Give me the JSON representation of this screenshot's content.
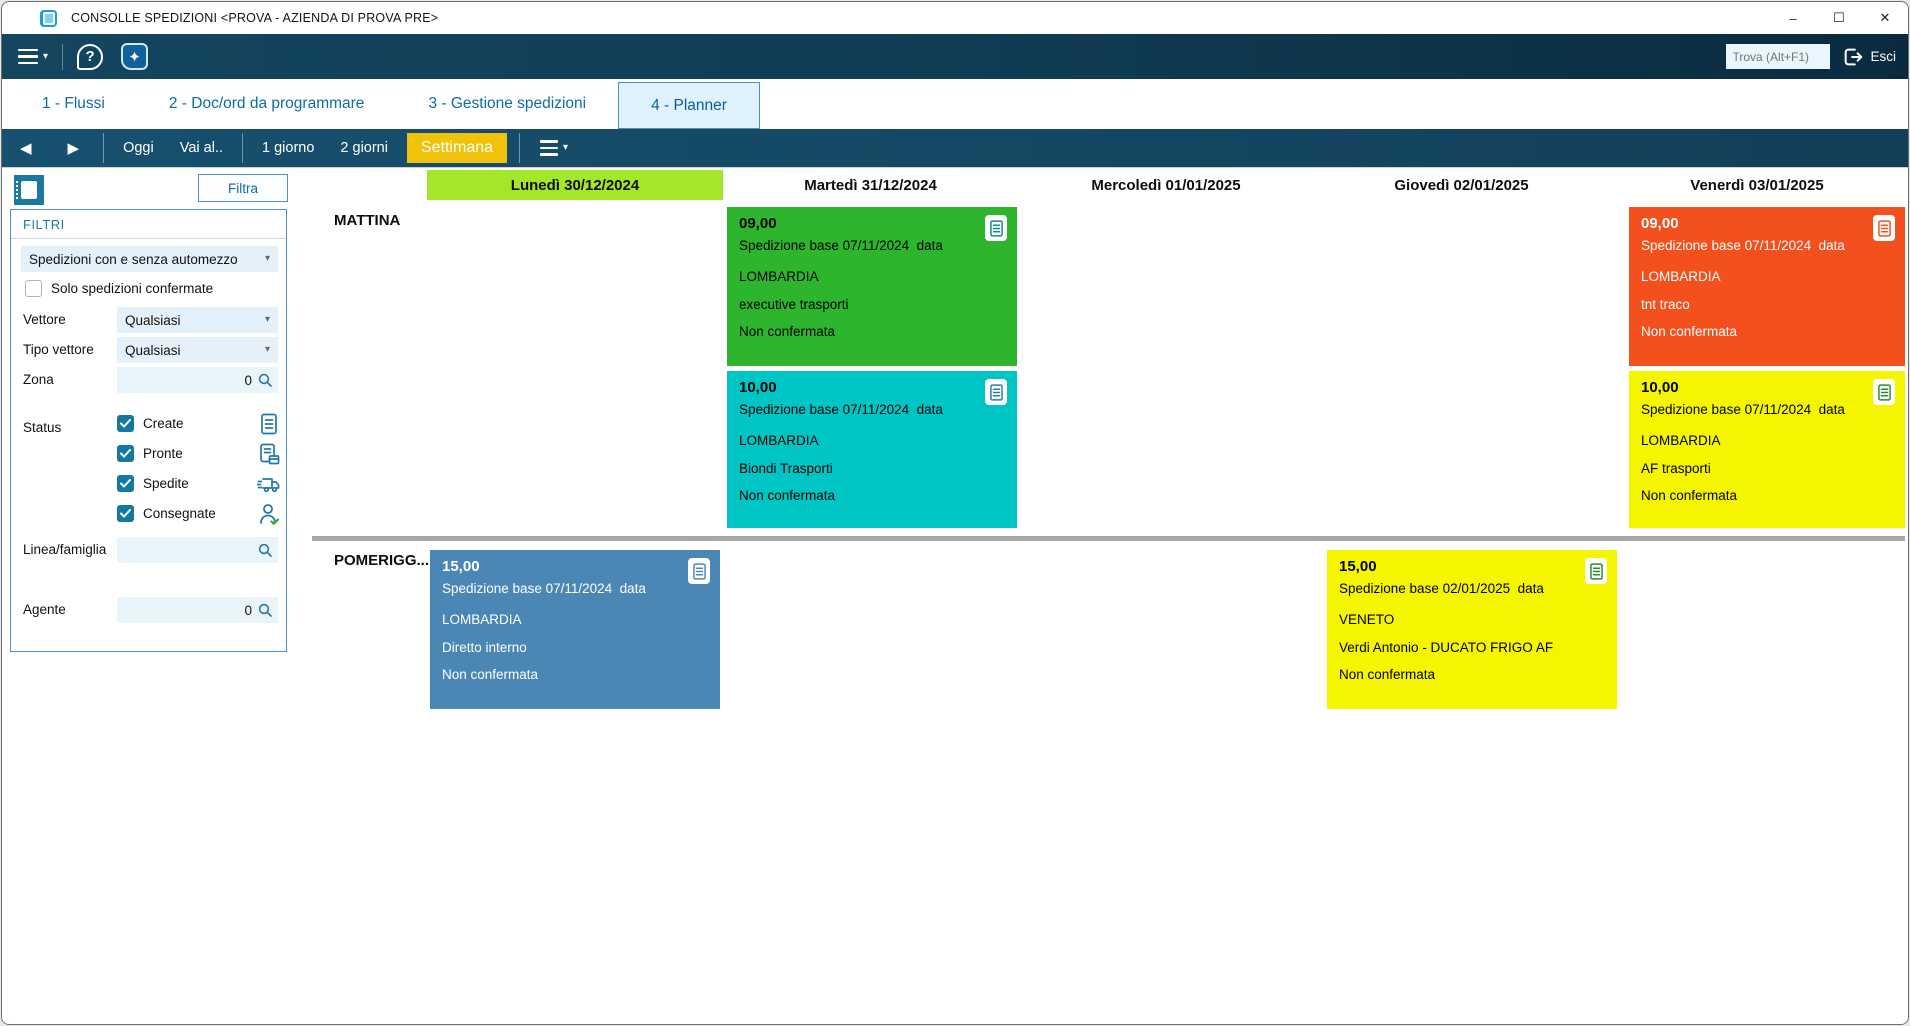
{
  "window": {
    "title": "CONSOLLE SPEDIZIONI <PROVA - AZIENDA DI PROVA PRE>",
    "controls": {
      "minimize": "–",
      "maximize": "☐",
      "close": "✕"
    }
  },
  "topbar": {
    "find_placeholder": "Trova (Alt+F1)",
    "exit_label": "Esci"
  },
  "tabs": [
    {
      "label": "1 - Flussi",
      "active": false
    },
    {
      "label": "2 - Doc/ord da programmare",
      "active": false
    },
    {
      "label": "3 - Gestione spedizioni",
      "active": false
    },
    {
      "label": "4 - Planner",
      "active": true
    }
  ],
  "nav": {
    "today_label": "Oggi",
    "goto_label": "Vai al..",
    "one_day_label": "1 giorno",
    "two_days_label": "2 giorni",
    "week_label": "Settimana",
    "prev_icon": "◀",
    "next_icon": "▶"
  },
  "filters": {
    "filtra_button_label": "Filtra",
    "panel_title": "FILTRI",
    "mode_dropdown_value": "Spedizioni con e senza automezzo",
    "confirmed_only_label": "Solo spedizioni confermate",
    "confirmed_only_checked": false,
    "vettore_label": "Vettore",
    "vettore_value": "Qualsiasi",
    "tipo_vettore_label": "Tipo vettore",
    "tipo_vettore_value": "Qualsiasi",
    "zona_label": "Zona",
    "zona_value": "0",
    "status_label": "Status",
    "status_items": [
      {
        "label": "Create",
        "checked": true,
        "icon": "document-icon"
      },
      {
        "label": "Pronte",
        "checked": true,
        "icon": "document-box-icon"
      },
      {
        "label": "Spedite",
        "checked": true,
        "icon": "truck-icon"
      },
      {
        "label": "Consegnate",
        "checked": true,
        "icon": "person-check-icon"
      }
    ],
    "linea_label": "Linea/famiglia",
    "agente_label": "Agente",
    "agente_value": "0"
  },
  "planner": {
    "day_headers": [
      "Lunedì 30/12/2024",
      "Martedì 31/12/2024",
      "Mercoledì 01/01/2025",
      "Giovedì 02/01/2025",
      "Venerdì 03/01/2025"
    ],
    "highlighted_day": "Lunedì 30/12/2024",
    "row_labels": {
      "morning": "MATTINA",
      "afternoon": "POMERIGG..."
    },
    "cards": [
      {
        "day": "Martedì 31/12/2024",
        "period": "MATTINA",
        "time": "09,00",
        "title": "Spedizione base 07/11/2024  data",
        "zone": "LOMBARDIA",
        "carrier": "executive trasporti",
        "status": "Non confermata",
        "color": "#2db52d",
        "text_color": "#000000"
      },
      {
        "day": "Martedì 31/12/2024",
        "period": "MATTINA",
        "time": "10,00",
        "title": "Spedizione base 07/11/2024  data",
        "zone": "LOMBARDIA",
        "carrier": "Biondi Trasporti",
        "status": "Non confermata",
        "color": "#00c5c5",
        "text_color": "#000000"
      },
      {
        "day": "Venerdì 03/01/2025",
        "period": "MATTINA",
        "time": "09,00",
        "title": "Spedizione base 07/11/2024  data",
        "zone": "LOMBARDIA",
        "carrier": "tnt traco",
        "status": "Non confermata",
        "color": "#f4501e",
        "text_color": "#ffffff"
      },
      {
        "day": "Venerdì 03/01/2025",
        "period": "MATTINA",
        "time": "10,00",
        "title": "Spedizione base 07/11/2024  data",
        "zone": "LOMBARDIA",
        "carrier": "AF trasporti",
        "status": "Non confermata",
        "color": "#f5f500",
        "text_color": "#000000"
      },
      {
        "day": "Lunedì 30/12/2024",
        "period": "POMERIGGIO",
        "time": "15,00",
        "title": "Spedizione base 07/11/2024  data",
        "zone": "LOMBARDIA",
        "carrier": "Diretto interno",
        "status": "Non confermata",
        "color": "#4b87b5",
        "text_color": "#ffffff"
      },
      {
        "day": "Giovedì 02/01/2025",
        "period": "POMERIGGIO",
        "time": "15,00",
        "title": "Spedizione base 02/01/2025  data",
        "zone": "VENETO",
        "carrier": "Verdi Antonio - DUCATO FRIGO AF",
        "status": "Non confermata",
        "color": "#f5f500",
        "text_color": "#000000"
      }
    ]
  },
  "colors": {
    "toolbar_teal": "#15506e",
    "week_button_yellow": "#f0c30a",
    "day_highlight_green": "#a4e72a",
    "tab_text_blue": "#0d6ba6",
    "filter_accent": "#1578a0"
  }
}
